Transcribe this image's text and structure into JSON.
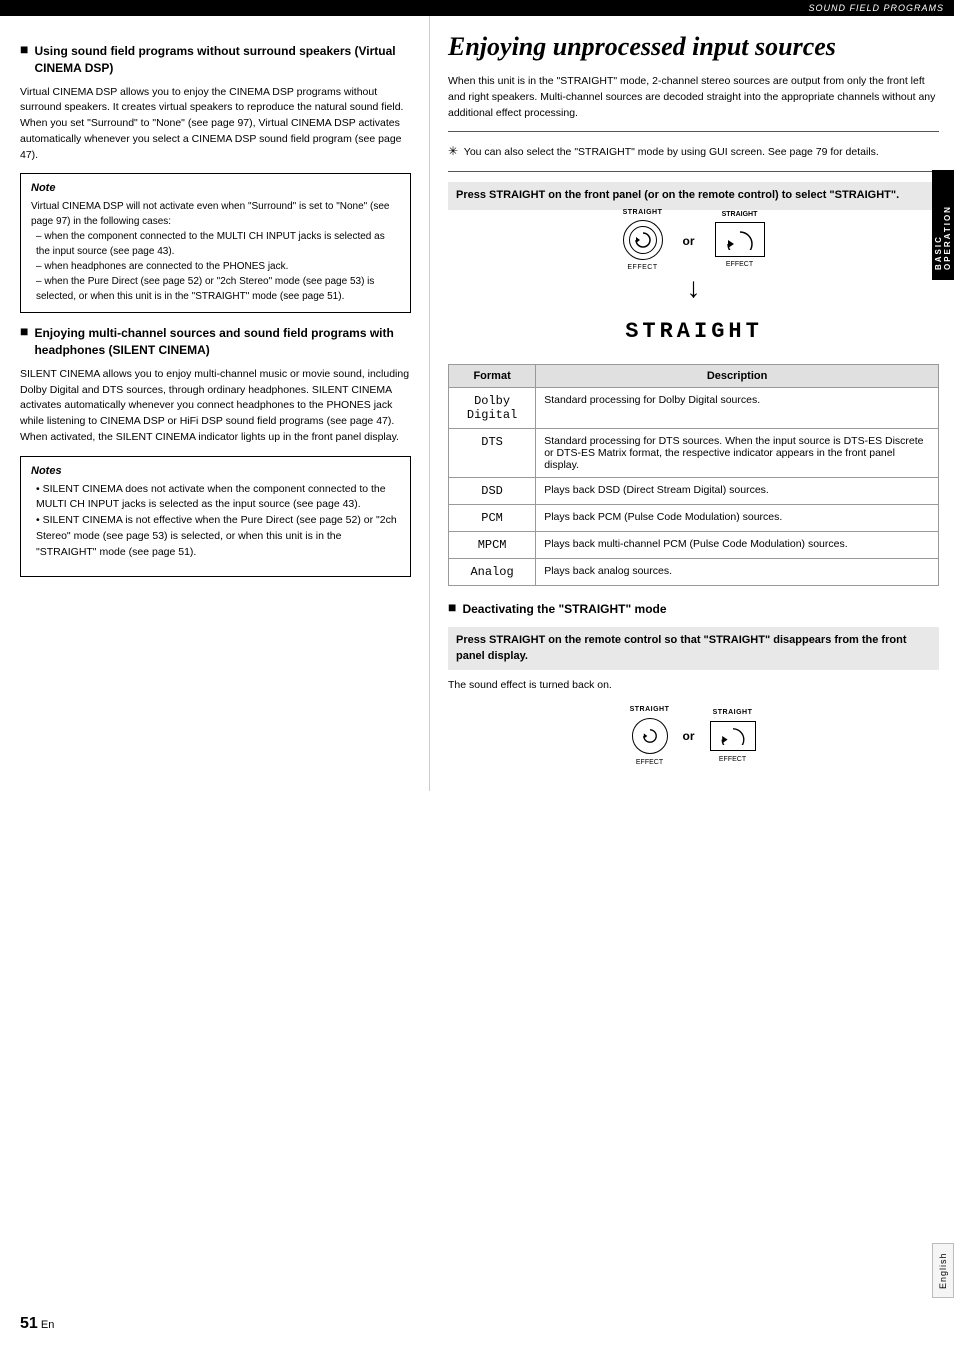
{
  "header": {
    "title": "SOUND FIELD PROGRAMS"
  },
  "left_column": {
    "section1": {
      "heading": "Using sound field programs without surround speakers (Virtual CINEMA DSP)",
      "body": "Virtual CINEMA DSP allows you to enjoy the CINEMA DSP programs without surround speakers. It creates virtual speakers to reproduce the natural sound field. When you set \"Surround\" to \"None\" (see page 97), Virtual CINEMA DSP activates automatically whenever you select a CINEMA DSP sound field program (see page 47).",
      "note": {
        "title": "Note",
        "body": "Virtual CINEMA DSP will not activate even when \"Surround\" is set to \"None\" (see page 97) in the following cases:",
        "items": [
          "when the component connected to the MULTI CH INPUT jacks is selected as the input source (see page 43).",
          "when headphones are connected to the PHONES jack.",
          "when the Pure Direct (see page 52) or \"2ch Stereo\" mode (see page 53) is selected, or when this unit is in the \"STRAIGHT\" mode (see page 51)."
        ]
      }
    },
    "section2": {
      "heading": "Enjoying multi-channel sources and sound field programs with headphones (SILENT CINEMA)",
      "body": "SILENT CINEMA allows you to enjoy multi-channel music or movie sound, including Dolby Digital and DTS sources, through ordinary headphones. SILENT CINEMA activates automatically whenever you connect headphones to the PHONES jack while listening to CINEMA DSP or HiFi DSP sound field programs (see page 47). When activated, the SILENT CINEMA indicator lights up in the front panel display.",
      "notes": {
        "title": "Notes",
        "items": [
          "SILENT CINEMA does not activate when the component connected to the MULTI CH INPUT jacks is selected as the input source (see page 43).",
          "SILENT CINEMA is not effective when the Pure Direct (see page 52) or \"2ch Stereo\" mode (see page 53) is selected, or when this unit is in the \"STRAIGHT\" mode (see page 51)."
        ]
      }
    }
  },
  "right_column": {
    "title": "Enjoying unprocessed input sources",
    "intro": "When this unit is in the \"STRAIGHT\" mode, 2-channel stereo sources are output from only the front left and right speakers. Multi-channel sources are decoded straight into the appropriate channels without any additional effect processing.",
    "tip": "You can also select the \"STRAIGHT\" mode by using GUI screen. See page 79 for details.",
    "press_instruction": "Press STRAIGHT on the front panel (or on the remote control) to select \"STRAIGHT\".",
    "button_label_left": "STRAIGHT",
    "button_label_right": "STRAIGHT",
    "effect_label": "EFFECT",
    "or_label": "or",
    "straight_display": "STRAIGHT",
    "table": {
      "headers": [
        "Format",
        "Description"
      ],
      "rows": [
        {
          "format": "Dolby Digital",
          "description": "Standard processing for Dolby Digital sources."
        },
        {
          "format": "DTS",
          "description": "Standard processing for DTS sources. When the input source is DTS-ES Discrete or DTS-ES Matrix format, the respective indicator appears in the front panel display."
        },
        {
          "format": "DSD",
          "description": "Plays back DSD (Direct Stream Digital) sources."
        },
        {
          "format": "PCM",
          "description": "Plays back PCM (Pulse Code Modulation) sources."
        },
        {
          "format": "MPCM",
          "description": "Plays back multi-channel PCM (Pulse Code Modulation) sources."
        },
        {
          "format": "Analog",
          "description": "Plays back analog sources."
        }
      ]
    },
    "deactivating": {
      "heading": "Deactivating the \"STRAIGHT\" mode",
      "instruction": "Press STRAIGHT on the remote control so that \"STRAIGHT\" disappears from the front panel display.",
      "result": "The sound effect is turned back on."
    }
  },
  "sidebar": {
    "basic_operation": "BASIC OPERATION",
    "english": "English"
  },
  "page": {
    "number": "51",
    "suffix": " En"
  }
}
